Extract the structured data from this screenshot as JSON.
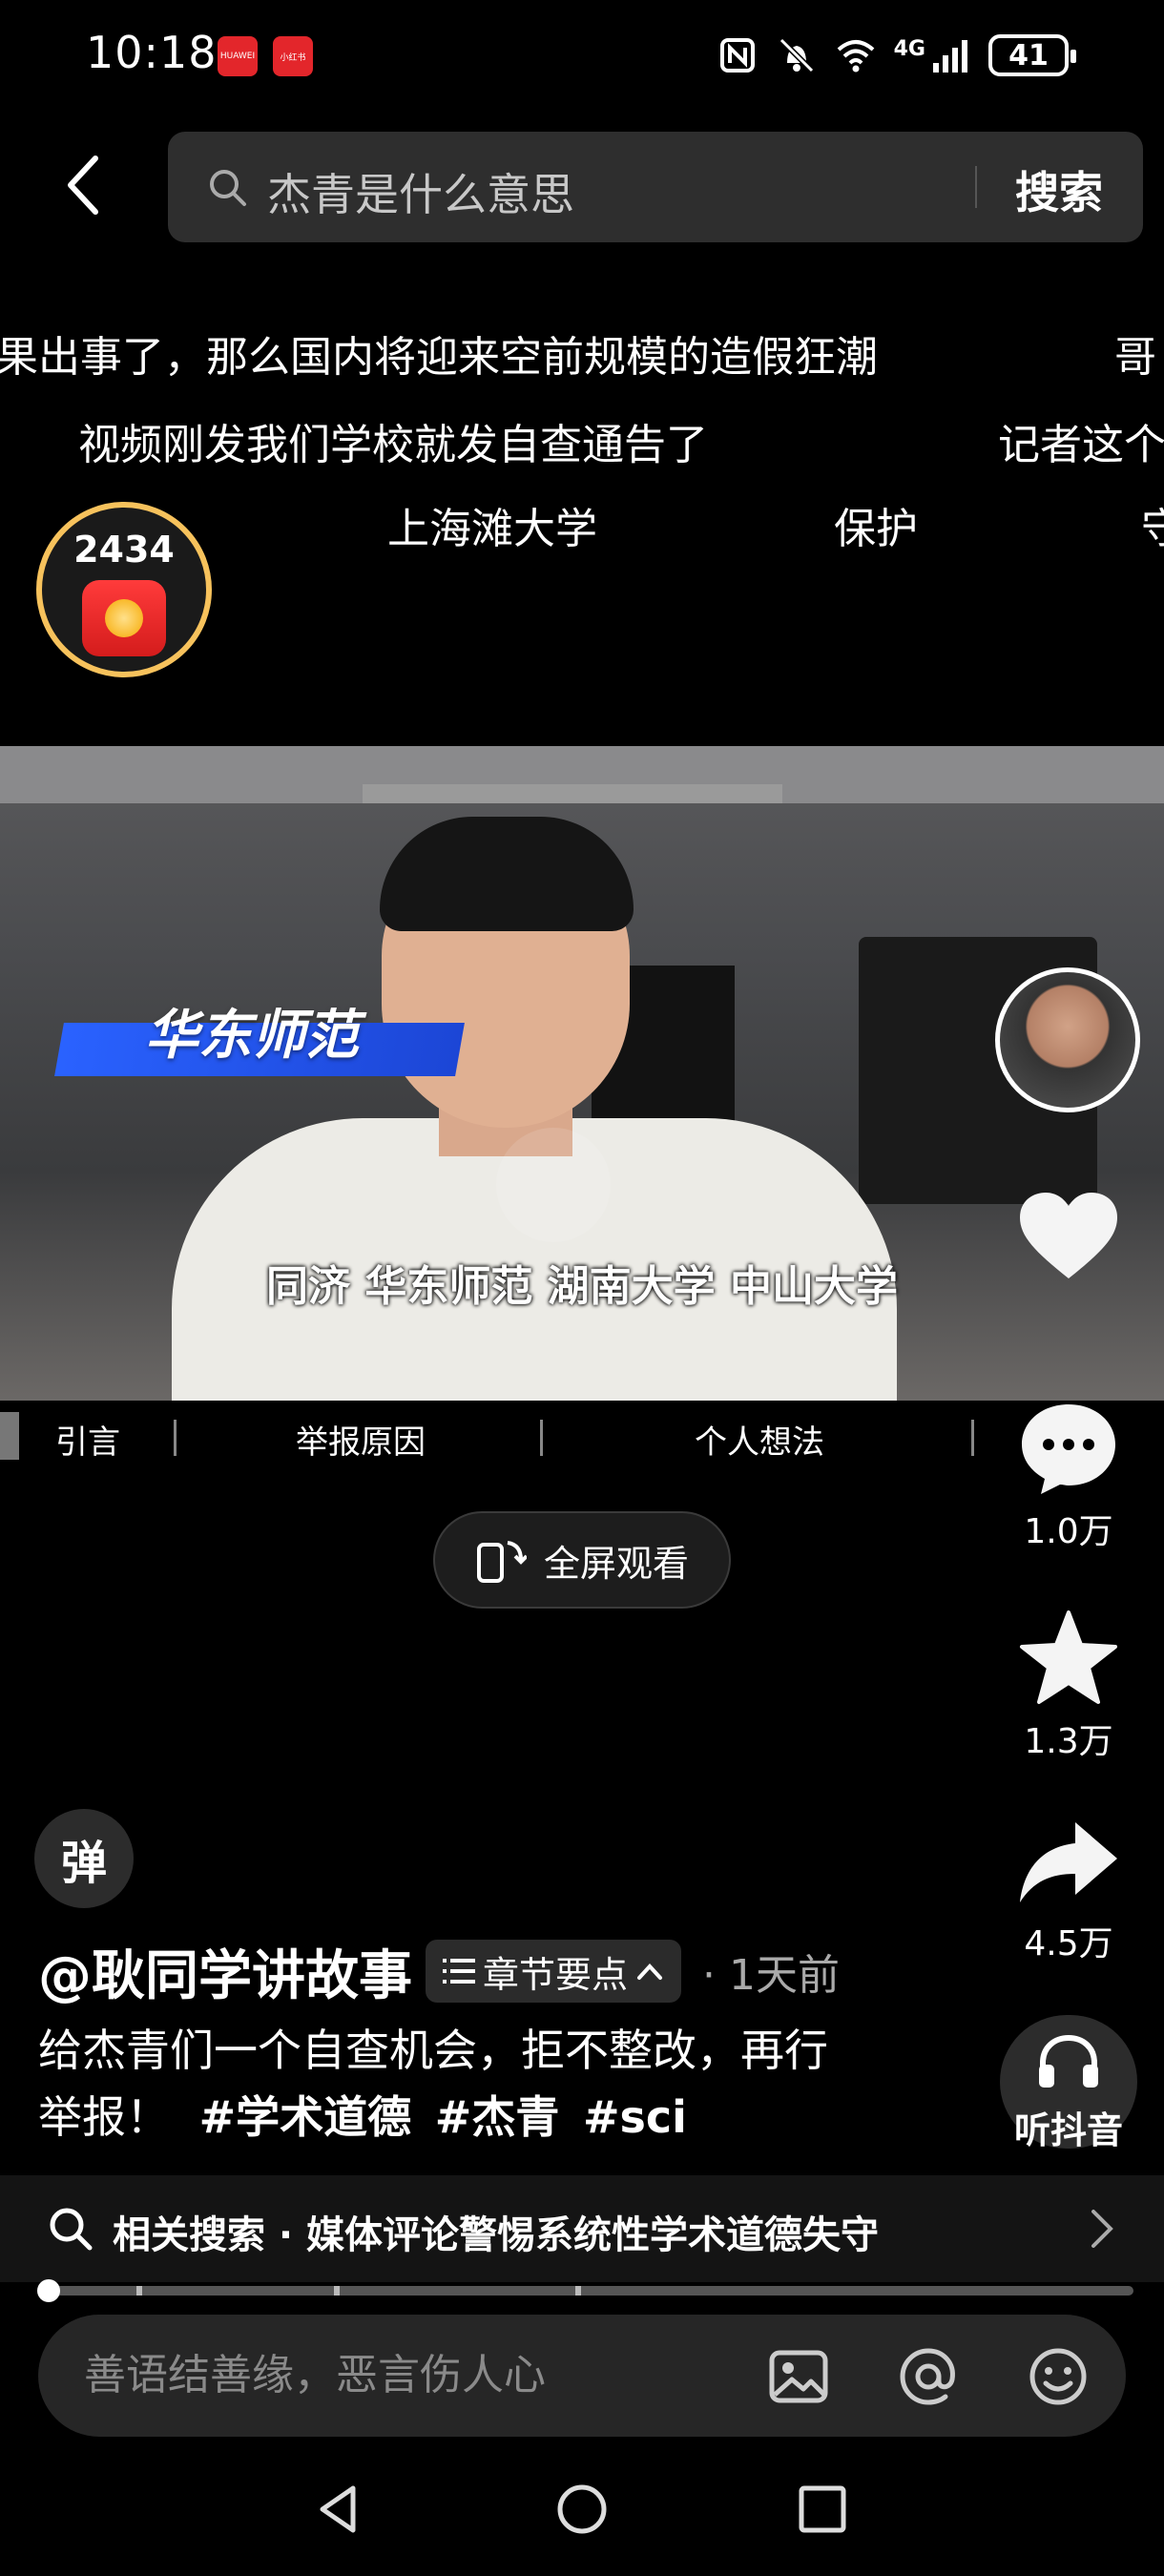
{
  "status_bar": {
    "time": "10:18",
    "badges": [
      "HUAWEI",
      "小红书"
    ],
    "network": "4G",
    "wifi_sub": "6",
    "battery": "41"
  },
  "search": {
    "query": "杰青是什么意思",
    "button": "搜索"
  },
  "danmaku": [
    "果出事了，那么国内将迎来空前规模的造假狂潮",
    "哥",
    "视频刚发我们学校就发自查通告了",
    "记者这个",
    "上海滩大学",
    "保护",
    "守"
  ],
  "red_packet": {
    "count": "2434"
  },
  "video": {
    "label": "华东师范",
    "subtitle": "同济 华东师范 湖南大学 中山大学"
  },
  "actions": {
    "like_count": "",
    "comment_count": "1.0万",
    "favorite_count": "1.3万",
    "share_count": "4.5万",
    "listen_label": "听抖音"
  },
  "chapters": [
    "引言",
    "举报原因",
    "个人想法"
  ],
  "fullscreen_label": "全屏观看",
  "danmu_toggle": "弹",
  "author": {
    "name": "@耿同学讲故事",
    "chapter_chip": "章节要点",
    "time": "· 1天前"
  },
  "caption": {
    "text_line1": "给杰青们一个自查机会，拒不整改，再行",
    "text_line2": "举报！",
    "hashtags": [
      "#学术道德",
      "#杰青",
      "#sci"
    ]
  },
  "related": {
    "text": "相关搜索 · 媒体评论警惕系统性学术道德失守"
  },
  "progress": {
    "fraction": 0.01,
    "ticks": [
      0.09,
      0.27,
      0.49
    ]
  },
  "comment": {
    "placeholder": "善语结善缘，恶言伤人心"
  },
  "colors": {
    "accent_red": "#e3262b",
    "gold": "#f7c25c",
    "label_blue": "#2a62ff"
  }
}
